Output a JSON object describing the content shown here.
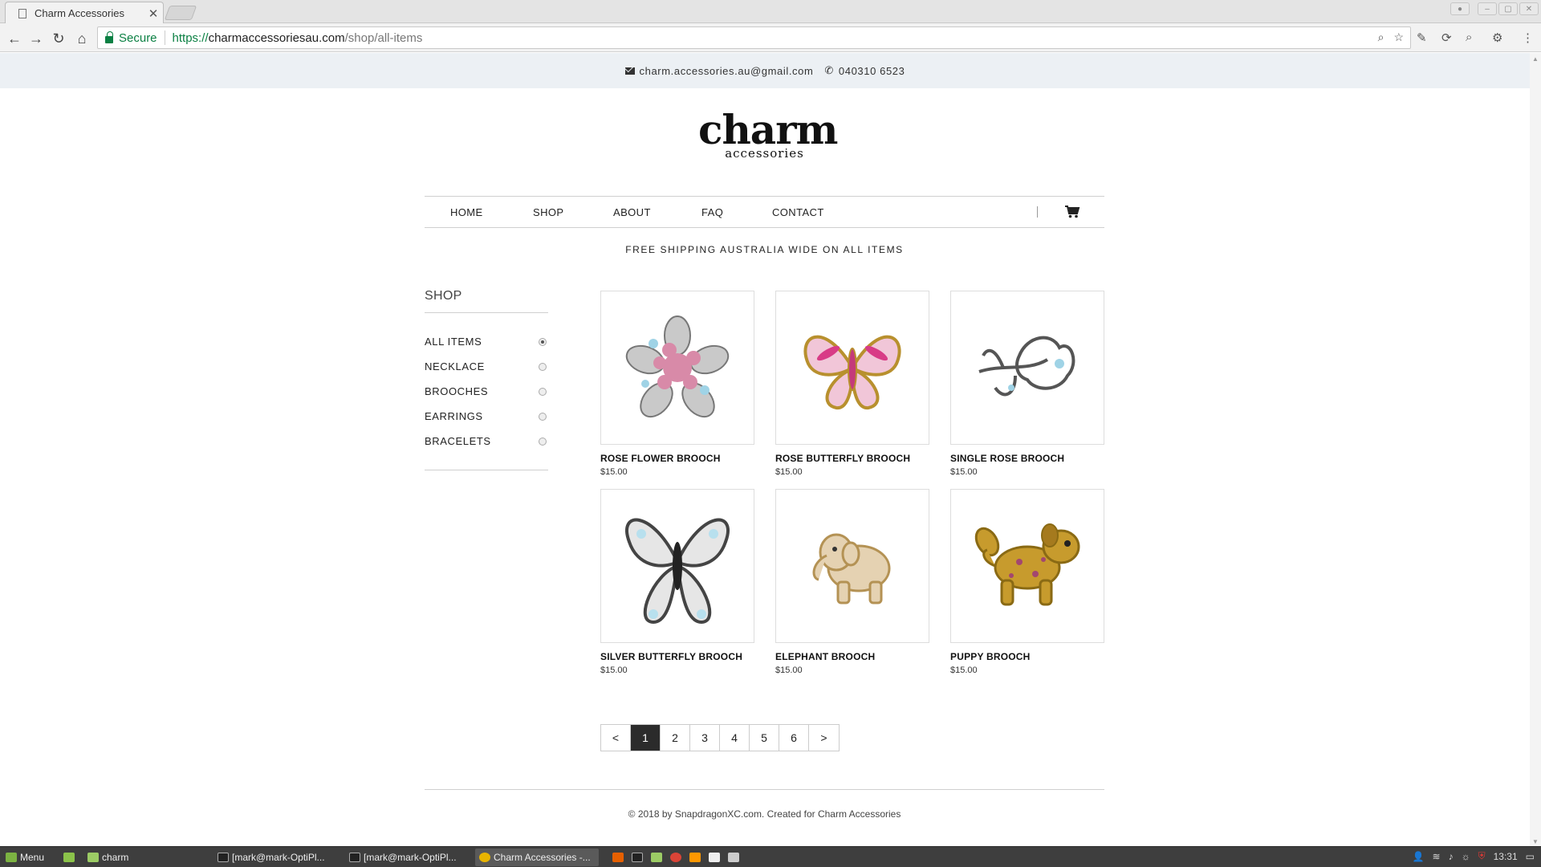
{
  "browser": {
    "tab_title": "Charm Accessories",
    "secure_label": "Secure",
    "url_scheme": "https://",
    "url_host": "charmaccessoriesau.com",
    "url_path": "/shop/all-items"
  },
  "topbar": {
    "email": "charm.accessories.au@gmail.com",
    "phone": "040310 6523"
  },
  "logo": {
    "main": "charm",
    "sub": "accessories"
  },
  "nav": {
    "items": [
      {
        "label": "HOME"
      },
      {
        "label": "SHOP"
      },
      {
        "label": "ABOUT"
      },
      {
        "label": "FAQ"
      },
      {
        "label": "CONTACT"
      }
    ]
  },
  "announcement": "FREE SHIPPING AUSTRALIA WIDE ON ALL ITEMS",
  "sidebar": {
    "title": "SHOP",
    "categories": [
      {
        "label": "ALL ITEMS",
        "selected": true
      },
      {
        "label": "NECKLACE",
        "selected": false
      },
      {
        "label": "BROOCHES",
        "selected": false
      },
      {
        "label": "EARRINGS",
        "selected": false
      },
      {
        "label": "BRACELETS",
        "selected": false
      }
    ]
  },
  "products": [
    {
      "name": "ROSE FLOWER BROOCH",
      "price": "$15.00"
    },
    {
      "name": "ROSE BUTTERFLY BROOCH",
      "price": "$15.00"
    },
    {
      "name": "SINGLE ROSE BROOCH",
      "price": "$15.00"
    },
    {
      "name": "SILVER BUTTERFLY BROOCH",
      "price": "$15.00"
    },
    {
      "name": "ELEPHANT BROOCH",
      "price": "$15.00"
    },
    {
      "name": "PUPPY BROOCH",
      "price": "$15.00"
    }
  ],
  "pagination": {
    "prev": "<",
    "pages": [
      "1",
      "2",
      "3",
      "4",
      "5",
      "6"
    ],
    "current": "1",
    "next": ">"
  },
  "footer": "© 2018 by SnapdragonXC.com. Created for Charm Accessories",
  "taskbar": {
    "menu": "Menu",
    "items": [
      {
        "label": "charm"
      },
      {
        "label": "[mark@mark-OptiPl..."
      },
      {
        "label": "[mark@mark-OptiPl..."
      },
      {
        "label": "Charm Accessories -..."
      }
    ],
    "clock": "13:31"
  }
}
